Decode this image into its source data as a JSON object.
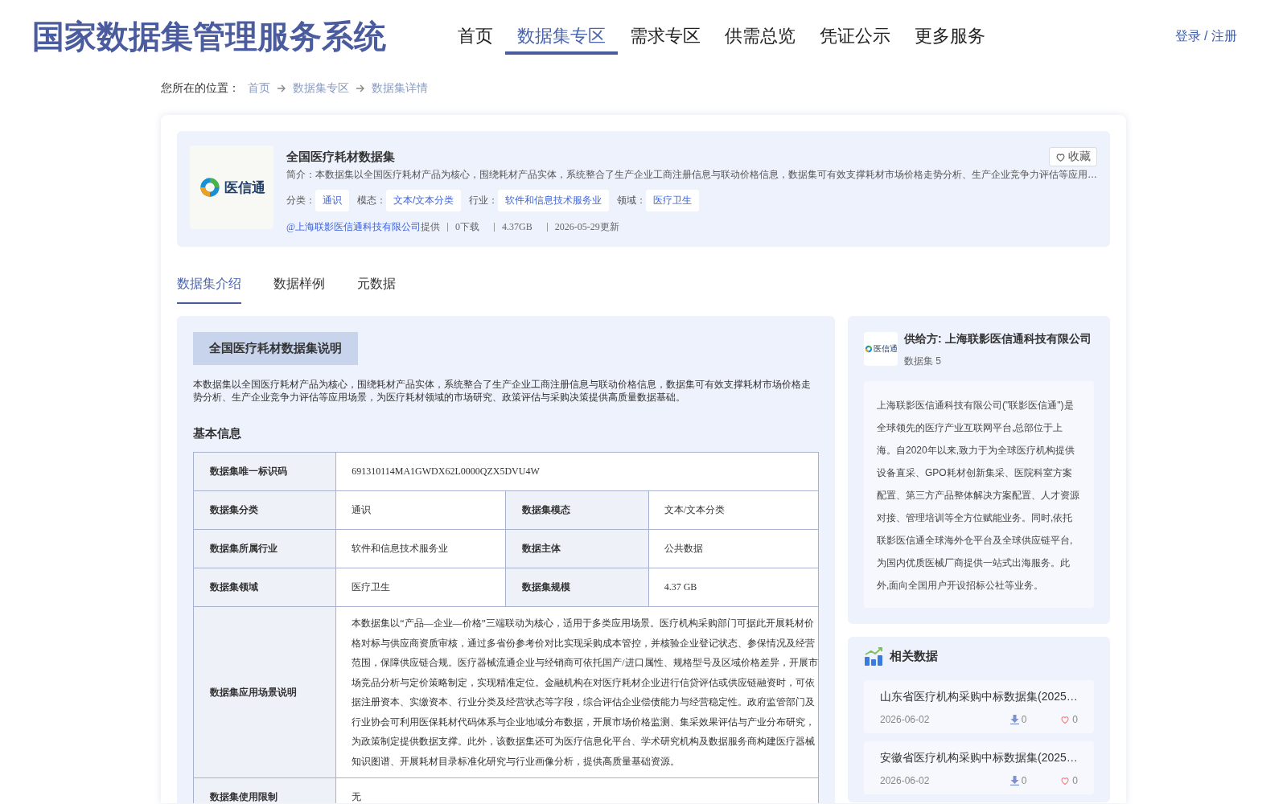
{
  "header": {
    "title": "国家数据集管理服务系统",
    "nav": [
      {
        "label": "首页",
        "selected": false
      },
      {
        "label": "数据集专区",
        "selected": true
      },
      {
        "label": "需求专区",
        "selected": false
      },
      {
        "label": "供需总览",
        "selected": false
      },
      {
        "label": "凭证公示",
        "selected": false
      },
      {
        "label": "更多服务",
        "selected": false
      }
    ],
    "auth": "登录 / 注册"
  },
  "breadcrumb": {
    "label": "您所在的位置：",
    "items": [
      "首页",
      "数据集专区",
      "数据集详情"
    ]
  },
  "dataset": {
    "logo_text": "医信通",
    "name": "全国医疗耗材数据集",
    "favorite": "收藏",
    "summary": "简介：本数据集以全国医疗耗材产品为核心，围绕耗材产品实体，系统整合了生产企业工商注册信息与联动价格信息，数据集可有效支撑耗材市场价格走势分析、生产企业竞争力评估等应用…",
    "tags": [
      {
        "label": "分类：",
        "value": "通识"
      },
      {
        "label": "模态：",
        "value": "文本/文本分类"
      },
      {
        "label": "行业：",
        "value": "软件和信息技术服务业"
      },
      {
        "label": "领域：",
        "value": "医疗卫生"
      }
    ],
    "provider": "@上海联影医信通科技有限公司",
    "provider_suffix": "提供",
    "stats": [
      "0下载",
      "4.37GB",
      "2026-05-29更新"
    ]
  },
  "tabs": [
    {
      "label": "数据集介绍",
      "selected": true
    },
    {
      "label": "数据样例",
      "selected": false
    },
    {
      "label": "元数据",
      "selected": false
    }
  ],
  "intro": {
    "heading": "全国医疗耗材数据集说明",
    "text": "本数据集以全国医疗耗材产品为核心，围绕耗材产品实体，系统整合了生产企业工商注册信息与联动价格信息，数据集可有效支撑耗材市场价格走势分析、生产企业竞争力评估等应用场景，为医疗耗材领域的市场研究、政策评估与采购决策提供高质量数据基础。",
    "section_title": "基本信息",
    "table": [
      [
        {
          "label": "数据集唯一标识码",
          "value": "691310114MA1GWDX62L0000QZX5DVU4W"
        }
      ],
      [
        {
          "label": "数据集分类",
          "value": "通识"
        },
        {
          "label": "数据集模态",
          "value": "文本/文本分类"
        }
      ],
      [
        {
          "label": "数据集所属行业",
          "value": "软件和信息技术服务业"
        },
        {
          "label": "数据主体",
          "value": "公共数据"
        }
      ],
      [
        {
          "label": "数据集领域",
          "value": "医疗卫生"
        },
        {
          "label": "数据集规模",
          "value": "4.37 GB"
        }
      ],
      [
        {
          "label": "数据集应用场景说明",
          "value": "本数据集以“产品—企业—价格”三端联动为核心，适用于多类应用场景。医疗机构采购部门可据此开展耗材价格对标与供应商资质审核，通过多省份参考价对比实现采购成本管控，并核验企业登记状态、参保情况及经营范围，保障供应链合规。医疗器械流通企业与经销商可依托国产/进口属性、规格型号及区域价格差异，开展市场竞品分析与定价策略制定，实现精准定位。金融机构在对医疗耗材企业进行信贷评估或供应链融资时，可依据注册资本、实缴资本、行业分类及经营状态等字段，综合评估企业偿债能力与经营稳定性。政府监管部门及行业协会可利用医保耗材代码体系与企业地域分布数据，开展市场价格监测、集采效果评估与产业分布研究，为政策制定提供数据支撑。此外，该数据集还可为医疗信息化平台、学术研究机构及数据服务商构建医疗器械知识图谱、开展耗材目录标准化研究与行业画像分析，提供高质量基础资源。"
        }
      ],
      [
        {
          "label": "数据集使用限制",
          "value": "无"
        }
      ]
    ]
  },
  "supplier": {
    "logo_text": "医信通",
    "name": "供给方: 上海联影医信通科技有限公司",
    "count": "数据集 5",
    "description": "上海联影医信通科技有限公司(\"联影医信通\")是全球领先的医疗产业互联网平台,总部位于上海。自2020年以来,致力于为全球医疗机构提供设备直采、GPO耗材创新集采、医院科室方案配置、第三方产品整体解决方案配置、人才资源对接、管理培训等全方位赋能业务。同时,依托联影医信通全球海外仓平台及全球供应链平台,为国内优质医械厂商提供一站式出海服务。此外,面向全国用户开设招标公社等业务。"
  },
  "related": {
    "title": "相关数据",
    "items": [
      {
        "title": "山东省医疗机构采购中标数据集(2025…",
        "date": "2026-06-02",
        "downloads": "0",
        "likes": "0"
      },
      {
        "title": "安徽省医疗机构采购中标数据集(2025…",
        "date": "2026-06-02",
        "downloads": "0",
        "likes": "0"
      }
    ]
  }
}
